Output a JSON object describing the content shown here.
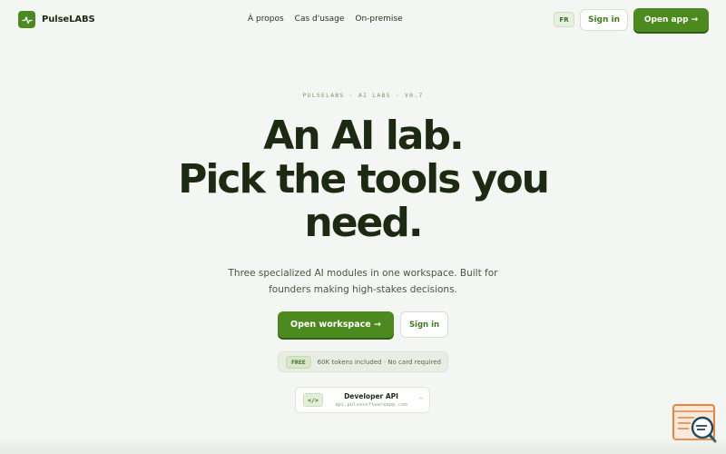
{
  "brand": {
    "name": "PulseLABS",
    "icon": "pulse-icon",
    "accent_color": "#4c8a1f"
  },
  "nav": {
    "links": [
      {
        "label": "À propos"
      },
      {
        "label": "Cas d'usage"
      },
      {
        "label": "On-premise"
      }
    ],
    "language_label": "FR",
    "signin_label": "Sign in",
    "open_app_label": "Open app →"
  },
  "hero": {
    "eyebrow": "PULSELABS · AI LABS · V0.7",
    "headline_lines": [
      "An AI lab.",
      "Pick the tools you",
      "need."
    ],
    "subtitle_lines": [
      "Three specialized AI modules in one workspace. Built for",
      "founders making high-stakes decisions."
    ],
    "primary_cta": "Open workspace →",
    "secondary_cta": "Sign in",
    "free_badge": "FREE",
    "free_text": "60K tokens included · No card required",
    "developer_api": {
      "icon": "code-icon",
      "icon_glyph": "</>",
      "title": "Developer API",
      "url": "api.pulsesoftwareapp.com",
      "chevron": "^"
    }
  },
  "widget": {
    "icon": "search-document-icon"
  }
}
